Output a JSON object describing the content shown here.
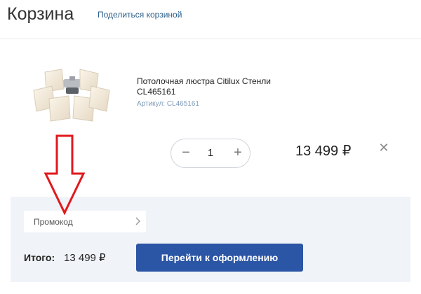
{
  "header": {
    "title": "Корзина",
    "share_link": "Поделиться корзиной"
  },
  "cart": {
    "items": [
      {
        "name": "Потолочная люстра Citilux Стенли CL465161",
        "sku": "Артикул: CL465161",
        "quantity": "1",
        "minus_symbol": "−",
        "plus_symbol": "+",
        "price": "13 499 ₽",
        "remove_symbol": "✕"
      }
    ]
  },
  "summary": {
    "promo_label": "Промокод",
    "total_label": "Итого:",
    "total_value": "13 499 ₽",
    "checkout_label": "Перейти к оформлению"
  },
  "colors": {
    "accent": "#2b55a5",
    "link": "#2c5f8a",
    "panel_background": "#f0f3f7",
    "annotation_arrow": "#e0191d"
  },
  "icons": {
    "product": "chandelier-image",
    "remove": "close-icon",
    "promo": "chevron-right-icon",
    "annotation": "down-arrow-icon"
  }
}
